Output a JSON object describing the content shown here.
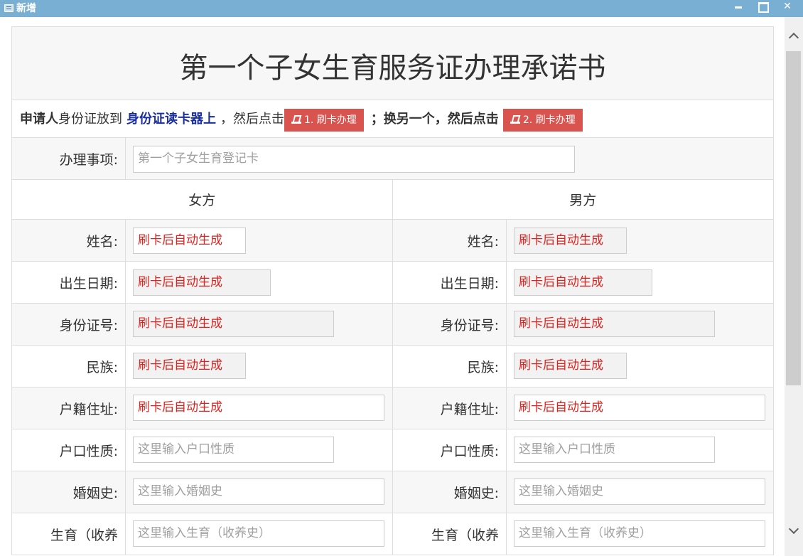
{
  "window": {
    "title": "新增",
    "icon": "form-window-icon",
    "controls": [
      "minimize-icon",
      "maximize-icon",
      "close-icon"
    ],
    "close_glyph": "✕"
  },
  "document": {
    "title": "第一个子女生育服务证办理承诺书"
  },
  "instructions": {
    "applicant": "申请人",
    "text1": "身份证放到",
    "reader": "身份证读卡器上",
    "text2": "，然后点击",
    "button1": "1. 刷卡办理",
    "text3": "；换另一个，然后点击",
    "button2": "2. 刷卡办理",
    "button_color": "#d9534f",
    "button_icon": "swipe-card-icon"
  },
  "item": {
    "label": "办理事项:",
    "value": "第一个子女生育登记卡"
  },
  "columns": {
    "female": "女方",
    "male": "男方"
  },
  "fields": [
    {
      "label": "姓名:",
      "female": "刷卡后自动生成",
      "male": "刷卡后自动生成",
      "kind": "auto"
    },
    {
      "label": "出生日期:",
      "female": "刷卡后自动生成",
      "male": "刷卡后自动生成",
      "kind": "auto"
    },
    {
      "label": "身份证号:",
      "female": "刷卡后自动生成",
      "male": "刷卡后自动生成",
      "kind": "auto"
    },
    {
      "label": "民族:",
      "female": "刷卡后自动生成",
      "male": "刷卡后自动生成",
      "kind": "auto"
    },
    {
      "label": "户籍住址:",
      "female": "刷卡后自动生成",
      "male": "刷卡后自动生成",
      "kind": "auto"
    },
    {
      "label": "户口性质:",
      "female_placeholder": "这里输入户口性质",
      "male_placeholder": "这里输入户口性质",
      "kind": "input"
    },
    {
      "label": "婚姻史:",
      "female_placeholder": "这里输入婚姻史",
      "male_placeholder": "这里输入婚姻史",
      "kind": "input"
    },
    {
      "label": "生育（收养",
      "female_placeholder": "这里输入生育（收养史）",
      "male_placeholder": "这里输入生育（收养史）",
      "kind": "input"
    }
  ],
  "colors": {
    "titlebar": "#7aafd4",
    "auto_text": "#d9231e",
    "reader_text": "#1a2fa0"
  }
}
